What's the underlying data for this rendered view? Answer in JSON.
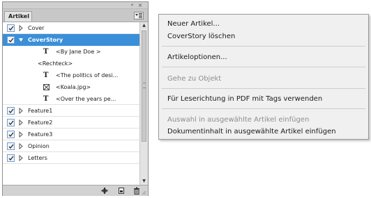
{
  "panel": {
    "tab_label": "Artikel",
    "collapse_glyph": "«",
    "close_glyph": "×",
    "items": [
      {
        "label": "Cover",
        "checked": true,
        "expanded": false
      },
      {
        "label": "CoverStory",
        "checked": true,
        "expanded": true,
        "selected": true
      },
      {
        "label": "<By Jane Doe >",
        "kind": "text",
        "icon": "text-frame-icon"
      },
      {
        "label": "<Rechteck>",
        "kind": "shape"
      },
      {
        "label": "<The politics of desi...",
        "kind": "text",
        "icon": "text-frame-icon"
      },
      {
        "label": "<Koala.jpg>",
        "kind": "image",
        "icon": "image-frame-icon"
      },
      {
        "label": "<Over the years pe...",
        "kind": "text",
        "icon": "text-frame-icon"
      },
      {
        "label": "Feature1",
        "checked": true,
        "expanded": false
      },
      {
        "label": "Feature2",
        "checked": true,
        "expanded": false
      },
      {
        "label": "Feature3",
        "checked": true,
        "expanded": false
      },
      {
        "label": "Opinion",
        "checked": true,
        "expanded": false
      },
      {
        "label": "Letters",
        "checked": true,
        "expanded": false
      }
    ],
    "text_glyph": "T",
    "scroll_up_glyph": "▲",
    "scroll_down_glyph": "▼",
    "bottom_buttons": [
      "add-content-icon",
      "new-article-icon",
      "trash-icon"
    ]
  },
  "menu": {
    "items": [
      {
        "label": "Neuer Artikel...",
        "enabled": true
      },
      {
        "label": "CoverStory löschen",
        "enabled": true
      },
      {
        "label": "Artikeloptionen...",
        "enabled": true
      },
      {
        "label": "Gehe zu Objekt",
        "enabled": false
      },
      {
        "label": "Für Leserichtung in PDF mit Tags verwenden",
        "enabled": true
      },
      {
        "label": "Auswahl in ausgewählte Artikel einfügen",
        "enabled": false
      },
      {
        "label": "Dokumentinhalt in ausgewählte Artikel einfügen",
        "enabled": true
      }
    ]
  },
  "colors": {
    "selection": "#3b8fd9",
    "menu_background": "#f0f0f0",
    "disabled_text": "#8d8d8d"
  }
}
